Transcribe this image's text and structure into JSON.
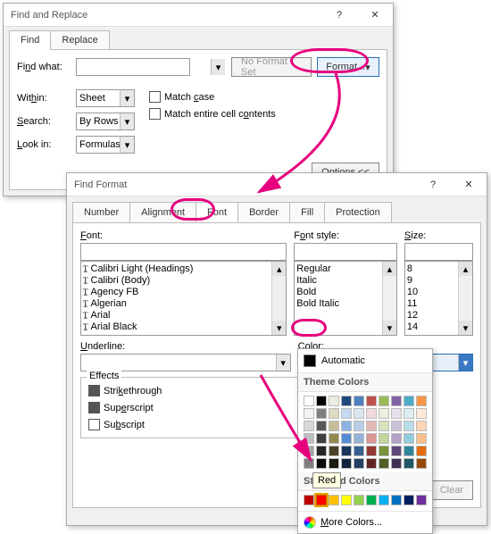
{
  "find_dialog": {
    "title": "Find and Replace",
    "tabs": {
      "find": "Find",
      "replace": "Replace"
    },
    "find_what_label": "Find what:",
    "find_what_value": "",
    "no_format_label": "No Format Set",
    "format_button": "Format...",
    "within_label": "Within:",
    "within_value": "Sheet",
    "search_label": "Search:",
    "search_value": "By Rows",
    "lookin_label": "Look in:",
    "lookin_value": "Formulas",
    "match_case": "Match case",
    "match_entire": "Match entire cell contents",
    "options_button": "Options <<"
  },
  "format_dialog": {
    "title": "Find Format",
    "tabs": {
      "number": "Number",
      "alignment": "Alignment",
      "font": "Font",
      "border": "Border",
      "fill": "Fill",
      "protection": "Protection"
    },
    "font_label": "Font:",
    "font_value": "",
    "fonts": [
      "Calibri Light (Headings)",
      "Calibri (Body)",
      "Agency FB",
      "Algerian",
      "Arial",
      "Arial Black"
    ],
    "style_label": "Font style:",
    "style_value": "",
    "styles": [
      "Regular",
      "Italic",
      "Bold",
      "Bold Italic"
    ],
    "size_label": "Size:",
    "size_value": "",
    "sizes": [
      "8",
      "9",
      "10",
      "11",
      "12",
      "14"
    ],
    "underline_label": "Underline:",
    "underline_value": "",
    "color_label": "Color:",
    "color_value": "Automatic",
    "effects_label": "Effects",
    "strike": "Strikethrough",
    "super": "Superscript",
    "sub": "Subscript",
    "clear_button": "Clear"
  },
  "color_popup": {
    "automatic": "Automatic",
    "theme_header": "Theme Colors",
    "theme_rows": [
      [
        "#ffffff",
        "#000000",
        "#eeece1",
        "#1f497d",
        "#4f81bd",
        "#c0504d",
        "#9bbb59",
        "#8064a2",
        "#4bacc6",
        "#f79646"
      ],
      [
        "#f2f2f2",
        "#7f7f7f",
        "#ddd9c3",
        "#c6d9f0",
        "#dbe5f1",
        "#f2dcdb",
        "#ebf1dd",
        "#e5e0ec",
        "#dbeef3",
        "#fdeada"
      ],
      [
        "#d8d8d8",
        "#595959",
        "#c4bd97",
        "#8db3e2",
        "#b8cce4",
        "#e5b9b7",
        "#d7e3bc",
        "#ccc1d9",
        "#b7dde8",
        "#fbd5b5"
      ],
      [
        "#bfbfbf",
        "#3f3f3f",
        "#938953",
        "#548dd4",
        "#95b3d7",
        "#d99694",
        "#c3d69b",
        "#b2a2c7",
        "#92cddc",
        "#fac08f"
      ],
      [
        "#a5a5a5",
        "#262626",
        "#494429",
        "#17365d",
        "#366092",
        "#953734",
        "#76923c",
        "#5f497a",
        "#31859b",
        "#e36c09"
      ],
      [
        "#7f7f7f",
        "#0c0c0c",
        "#1d1b10",
        "#0f243e",
        "#244061",
        "#632423",
        "#4f6128",
        "#3f3151",
        "#205867",
        "#974806"
      ]
    ],
    "standard_header": "Standard Colors",
    "standard": [
      "#c00000",
      "#ff0000",
      "#ffc000",
      "#ffff00",
      "#92d050",
      "#00b050",
      "#00b0f0",
      "#0070c0",
      "#002060",
      "#7030a0"
    ],
    "selected_index": 1,
    "more_colors": "More Colors...",
    "tooltip": "Red"
  }
}
